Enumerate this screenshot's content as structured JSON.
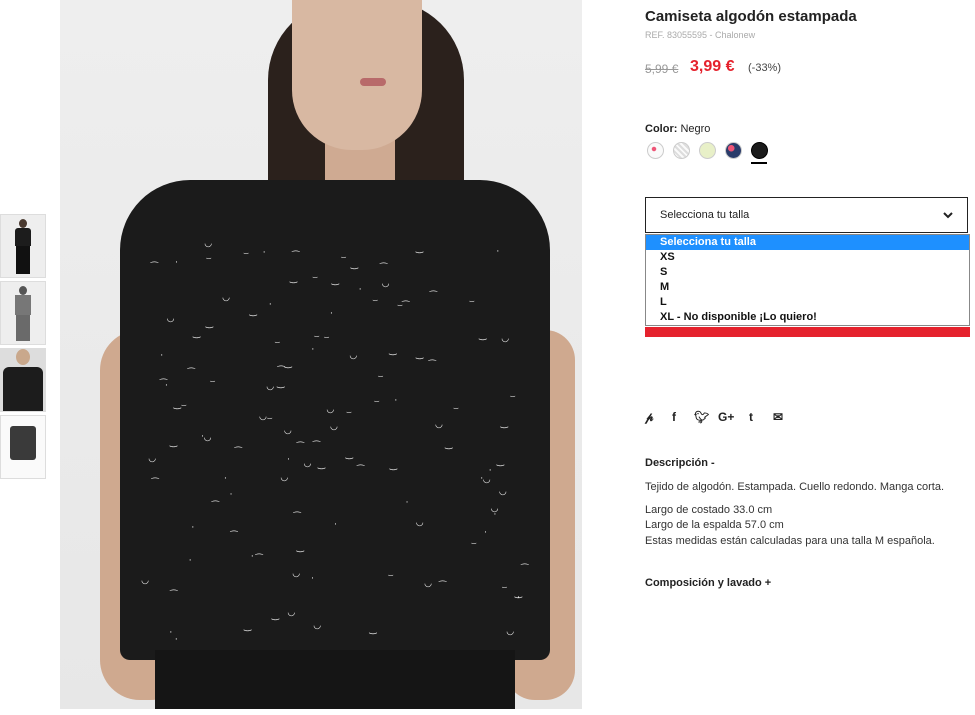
{
  "thumbnails": [
    {
      "alt": "front-view-full"
    },
    {
      "alt": "side-view-full"
    },
    {
      "alt": "detail-view"
    },
    {
      "alt": "product-only"
    }
  ],
  "product": {
    "title": "Camiseta algodón estampada",
    "ref": "REF. 83055595 - Chalonew",
    "old_price": "5,99 €",
    "new_price": "3,99 €",
    "discount": "(-33%)"
  },
  "color": {
    "label": "Color:",
    "value": "Negro"
  },
  "size_select": {
    "placeholder": "Selecciona tu talla",
    "options": [
      "Selecciona tu talla",
      "XS",
      "S",
      "M",
      "L",
      "XL - No disponible ¡Lo quiero!"
    ]
  },
  "share_icons": [
    "pinterest-icon",
    "facebook-icon",
    "twitter-icon",
    "google-plus-icon",
    "tumblr-icon",
    "email-icon"
  ],
  "description": {
    "heading": "Descripción -",
    "line1": "Tejido de algodón. Estampada. Cuello redondo. Manga corta.",
    "line2": "Largo de costado 33.0 cm",
    "line3": "Largo de la espalda 57.0 cm",
    "line4": "Estas medidas están calculadas para una talla M española."
  },
  "composition": {
    "heading": "Composición y lavado +"
  },
  "colors": {
    "price_red": "#e5222d",
    "select_blue": "#1e90ff"
  }
}
